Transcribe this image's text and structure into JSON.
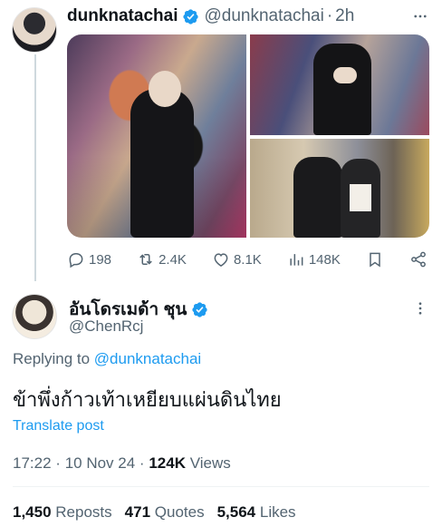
{
  "parent": {
    "name": "dunknatachai",
    "handle": "@dunknatachai",
    "separator": "·",
    "time": "2h",
    "actions": {
      "replies": "198",
      "reposts": "2.4K",
      "likes": "8.1K",
      "views": "148K"
    }
  },
  "reply": {
    "name": "อันโดรเมด้า ชุน",
    "handle": "@ChenRcj",
    "replying_prefix": "Replying to",
    "replying_to": "@dunknatachai",
    "text": "ข้าพึ่งก้าวเท้าเหยียบแผ่นดินไทย",
    "translate_label": "Translate post",
    "time": "17:22",
    "dot1": "·",
    "date": "10 Nov 24",
    "dot2": "·",
    "views_count": "124K",
    "views_label": "Views",
    "stats": {
      "reposts_count": "1,450",
      "reposts_label": "Reposts",
      "quotes_count": "471",
      "quotes_label": "Quotes",
      "likes_count": "5,564",
      "likes_label": "Likes"
    }
  },
  "colors": {
    "accent": "#1d9bf0",
    "secondary_text": "#536471",
    "primary_text": "#0f1419"
  },
  "icons": [
    "verified-badge-icon",
    "more-icon",
    "reply-icon",
    "repost-icon",
    "like-icon",
    "views-icon",
    "bookmark-icon",
    "share-icon"
  ]
}
